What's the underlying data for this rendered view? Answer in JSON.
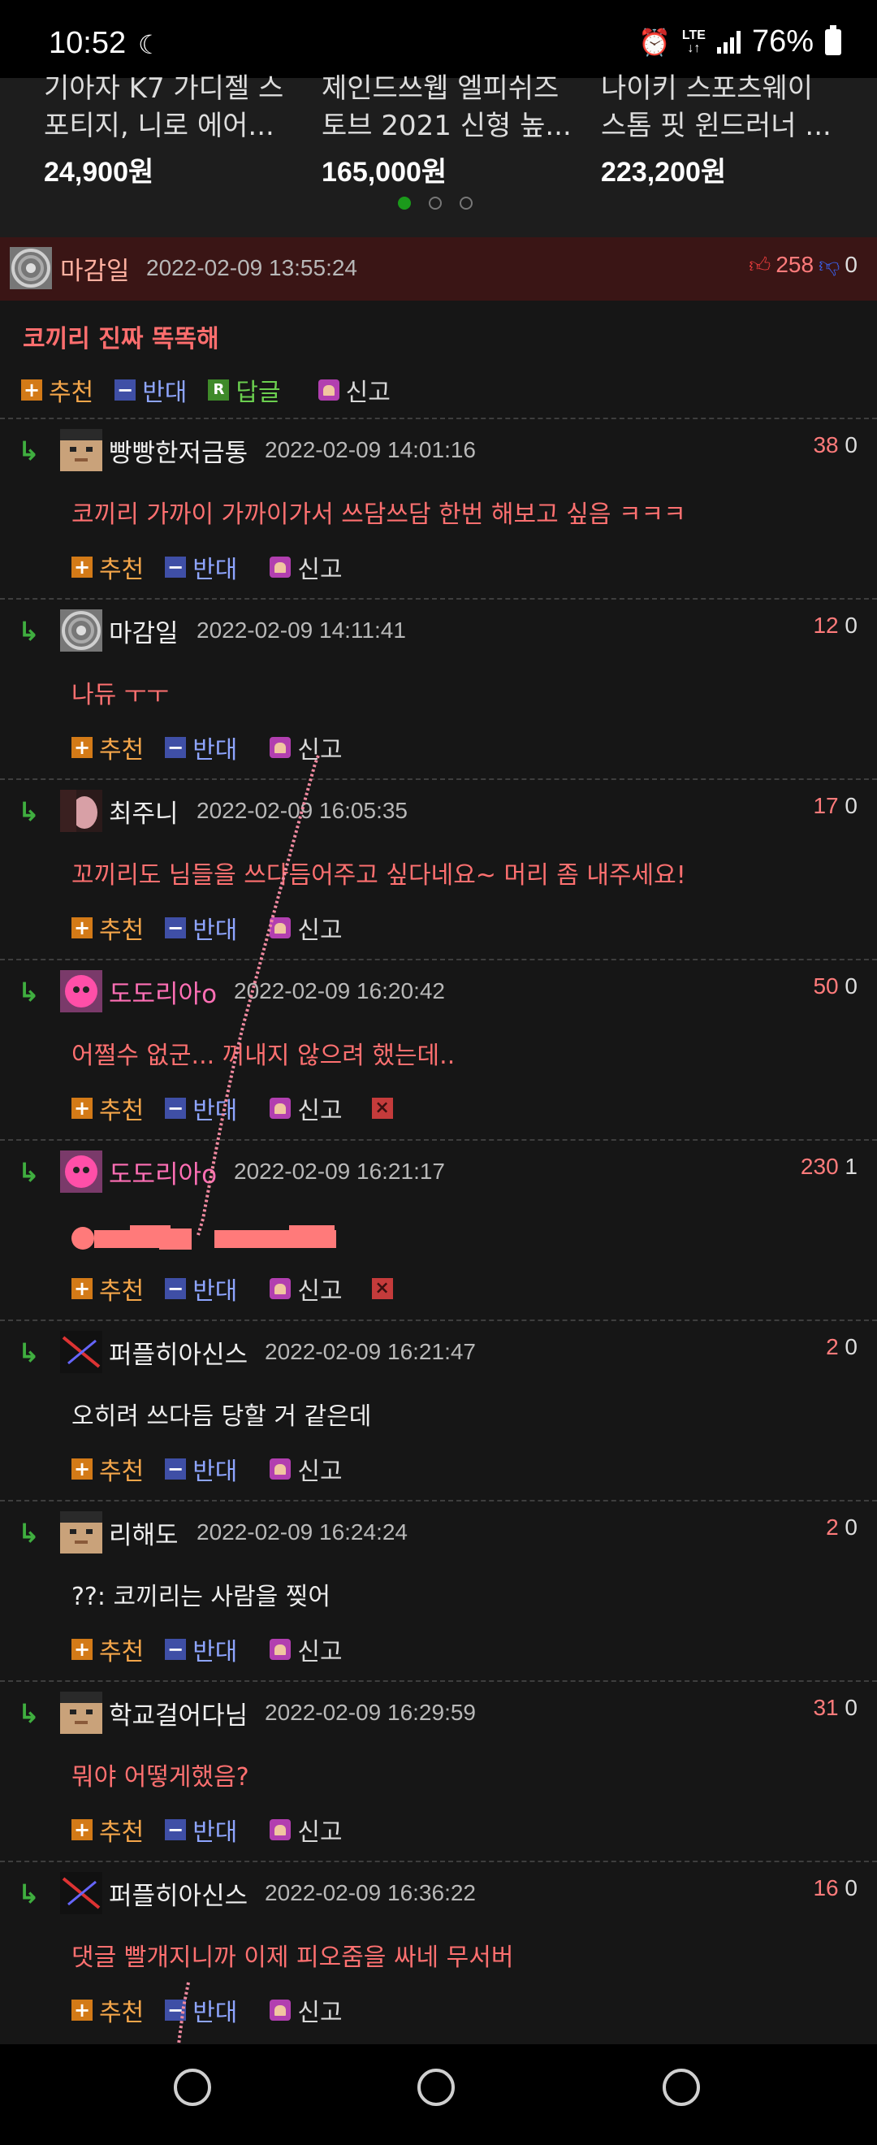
{
  "status_bar": {
    "time": "10:52",
    "network": "LTE",
    "battery": "76%"
  },
  "products": [
    {
      "name": "기아자 K7 가디젤 스\n포티지, 니로 에어...",
      "price": "24,900원"
    },
    {
      "name": "제인드쓰웹 엘피쉬즈\n토브 2021 신형 높...",
      "price": "165,000원"
    },
    {
      "name": "나이키 스포츠웨이\n스톰 핏 윈드러너 ...",
      "price": "223,200원"
    }
  ],
  "parent_comment": {
    "username": "마감일",
    "date": "2022-02-09 13:55:24",
    "upvotes": "258",
    "downvotes": "0",
    "text": "코끼리 진짜 똑똑해",
    "actions": {
      "up": "추천",
      "down": "반대",
      "reply": "답글",
      "report": "신고"
    }
  },
  "action_labels": {
    "up": "추천",
    "down": "반대",
    "report": "신고"
  },
  "comments": [
    {
      "username": "빵빵한저금통",
      "date": "2022-02-09 14:01:16",
      "up": "38",
      "down": "0",
      "text": "코끼리 가까이 가까이가서 쓰담쓰담 한번 해보고 싶음 ㅋㅋㅋ"
    },
    {
      "username": "마감일",
      "date": "2022-02-09 14:11:41",
      "up": "12",
      "down": "0",
      "text": "나듀 ㅜㅜ"
    },
    {
      "username": "최주니",
      "date": "2022-02-09 16:05:35",
      "up": "17",
      "down": "0",
      "text": "꼬끼리도 님들을 쓰다듬어주고 싶다네요~ 머리 좀 내주세요!"
    },
    {
      "username": "도도리아o",
      "date": "2022-02-09 16:20:42",
      "up": "50",
      "down": "0",
      "text": "어쩔수 없군... 꺼내지 않으려 했는데.."
    },
    {
      "username": "도도리아o",
      "date": "2022-02-09 16:21:17",
      "up": "230",
      "down": "1",
      "text": ""
    },
    {
      "username": "퍼플히아신스",
      "date": "2022-02-09 16:21:47",
      "up": "2",
      "down": "0",
      "text": "오히려 쓰다듬 당할 거 같은데"
    },
    {
      "username": "리해도",
      "date": "2022-02-09 16:24:24",
      "up": "2",
      "down": "0",
      "text": "??: 코끼리는 사람을 찢어"
    },
    {
      "username": "학교걸어다님",
      "date": "2022-02-09 16:29:59",
      "up": "31",
      "down": "0",
      "text": "뭐야 어떻게했음?"
    },
    {
      "username": "퍼플히아신스",
      "date": "2022-02-09 16:36:22",
      "up": "16",
      "down": "0",
      "text": "댓글 빨개지니까 이제 피오줌을 싸네 무서버"
    }
  ]
}
